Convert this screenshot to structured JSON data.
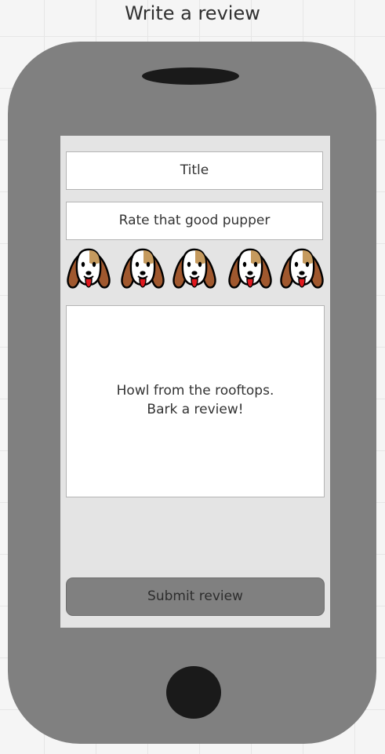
{
  "page": {
    "heading": "Write a review"
  },
  "form": {
    "title_placeholder": "Title",
    "rating_label": "Rate that good pupper",
    "rating": {
      "max": 5,
      "icon": "beagle-face-icon"
    },
    "review_placeholder": "Howl from the rooftops.\nBark a review!",
    "submit_label": "Submit review"
  },
  "colors": {
    "phone_body": "#808080",
    "screen_background": "#e4e4e4",
    "submit_button": "#808080",
    "pup_brown": "#a0582e",
    "pup_tan": "#c59a5e",
    "pup_tongue": "#e0181e"
  }
}
